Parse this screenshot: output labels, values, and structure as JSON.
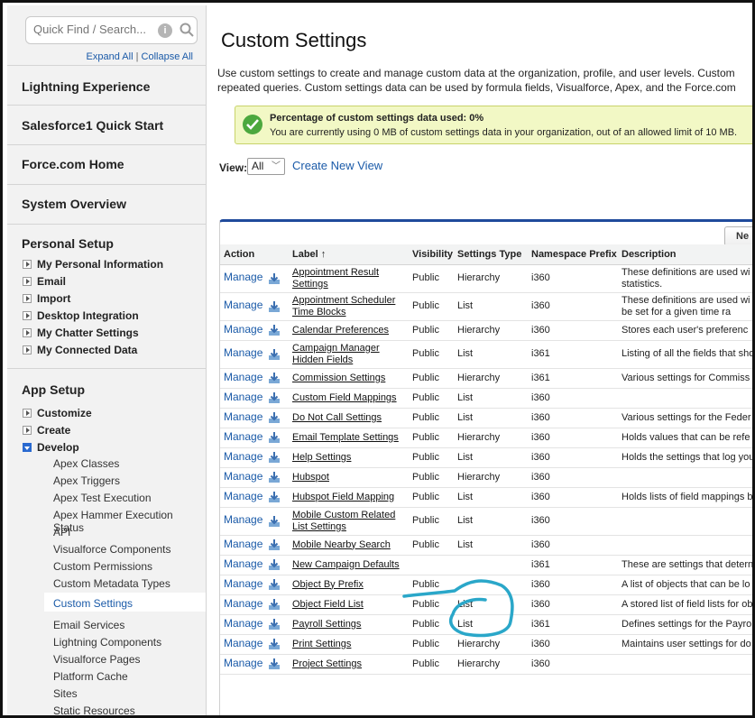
{
  "sidebar": {
    "search_placeholder": "Quick Find / Search...",
    "expand_all": "Expand All",
    "separator": "|",
    "collapse_all": "Collapse All",
    "sections": {
      "lightning": "Lightning Experience",
      "sf1": "Salesforce1 Quick Start",
      "force_home": "Force.com Home",
      "overview": "System Overview",
      "personal_setup": "Personal Setup",
      "app_setup": "App Setup"
    },
    "personal_items": [
      "My Personal Information",
      "Email",
      "Import",
      "Desktop Integration",
      "My Chatter Settings",
      "My Connected Data"
    ],
    "app_items": [
      "Customize",
      "Create",
      "Develop"
    ],
    "develop_items": [
      "Apex Classes",
      "Apex Triggers",
      "Apex Test Execution",
      "Apex Hammer Execution Status",
      "API",
      "Visualforce Components",
      "Custom Permissions",
      "Custom Metadata Types",
      "Custom Settings",
      "Email Services",
      "Lightning Components",
      "Visualforce Pages",
      "Platform Cache",
      "Sites",
      "Static Resources"
    ]
  },
  "main": {
    "title": "Custom Settings",
    "desc_line1": "Use custom settings to create and manage custom data at the organization, profile, and user levels. Custom",
    "desc_line2": "repeated queries. Custom settings data can be used by formula fields, Visualforce, Apex, and the Force.com",
    "notice_title": "Percentage of custom settings data used: 0%",
    "notice_text": "You are currently using 0 MB of custom settings data in your organization, out of an allowed limit of 10 MB.",
    "view_label": "View:",
    "view_value": "All",
    "create_view": "Create New View",
    "new_button": "Ne"
  },
  "table": {
    "headers": {
      "action": "Action",
      "label": "Label ↑",
      "visibility": "Visibility",
      "type": "Settings Type",
      "ns": "Namespace Prefix",
      "desc": "Description"
    },
    "manage_label": "Manage",
    "rows": [
      {
        "label": "Appointment Result Settings",
        "vis": "Public",
        "type": "Hierarchy",
        "ns": "i360",
        "desc": "These definitions are used wi statistics."
      },
      {
        "label": "Appointment Scheduler Time Blocks",
        "vis": "Public",
        "type": "List",
        "ns": "i360",
        "desc": "These definitions are used wi can be set for a given time ra"
      },
      {
        "label": "Calendar Preferences",
        "vis": "Public",
        "type": "Hierarchy",
        "ns": "i360",
        "desc": "Stores each user's preferenc"
      },
      {
        "label": "Campaign Manager Hidden Fields",
        "vis": "Public",
        "type": "List",
        "ns": "i361",
        "desc": "Listing of all the fields that sho"
      },
      {
        "label": "Commission Settings",
        "vis": "Public",
        "type": "Hierarchy",
        "ns": "i361",
        "desc": "Various settings for Commiss"
      },
      {
        "label": "Custom Field Mappings",
        "vis": "Public",
        "type": "List",
        "ns": "i360",
        "desc": ""
      },
      {
        "label": "Do Not Call Settings",
        "vis": "Public",
        "type": "List",
        "ns": "i360",
        "desc": "Various settings for the Feder"
      },
      {
        "label": "Email Template Settings",
        "vis": "Public",
        "type": "Hierarchy",
        "ns": "i360",
        "desc": "Holds values that can be refe"
      },
      {
        "label": "Help Settings",
        "vis": "Public",
        "type": "List",
        "ns": "i360",
        "desc": "Holds the settings that log you"
      },
      {
        "label": "Hubspot",
        "vis": "Public",
        "type": "Hierarchy",
        "ns": "i360",
        "desc": ""
      },
      {
        "label": "Hubspot Field Mapping",
        "vis": "Public",
        "type": "List",
        "ns": "i360",
        "desc": "Holds lists of field mappings b"
      },
      {
        "label": "Mobile Custom Related List Settings",
        "vis": "Public",
        "type": "List",
        "ns": "i360",
        "desc": ""
      },
      {
        "label": "Mobile Nearby Search",
        "vis": "Public",
        "type": "List",
        "ns": "i360",
        "desc": ""
      },
      {
        "label": "New Campaign Defaults",
        "vis": "",
        "type": "",
        "ns": "i361",
        "desc": "These are settings that detern"
      },
      {
        "label": "Object By Prefix",
        "vis": "Public",
        "type": "",
        "ns": "i360",
        "desc": "A list of objects that can be lo"
      },
      {
        "label": "Object Field List",
        "vis": "Public",
        "type": "List",
        "ns": "i360",
        "desc": "A stored list of field lists for ob"
      },
      {
        "label": "Payroll Settings",
        "vis": "Public",
        "type": "List",
        "ns": "i361",
        "desc": "Defines settings for the Payro"
      },
      {
        "label": "Print Settings",
        "vis": "Public",
        "type": "Hierarchy",
        "ns": "i360",
        "desc": "Maintains user settings for do"
      },
      {
        "label": "Project Settings",
        "vis": "Public",
        "type": "Hierarchy",
        "ns": "i360",
        "desc": ""
      }
    ]
  },
  "colors": {
    "link": "#1a5aa8",
    "notice_bg": "#f2f8c5",
    "table_accent": "#1f4a9b",
    "annotation": "#2aa7c9",
    "check": "#4ca83e"
  },
  "icons": [
    "search-icon",
    "info-icon",
    "check-icon",
    "download-icon",
    "chevron-down-icon",
    "triangle-icon",
    "hand-pointer-annotation"
  ]
}
